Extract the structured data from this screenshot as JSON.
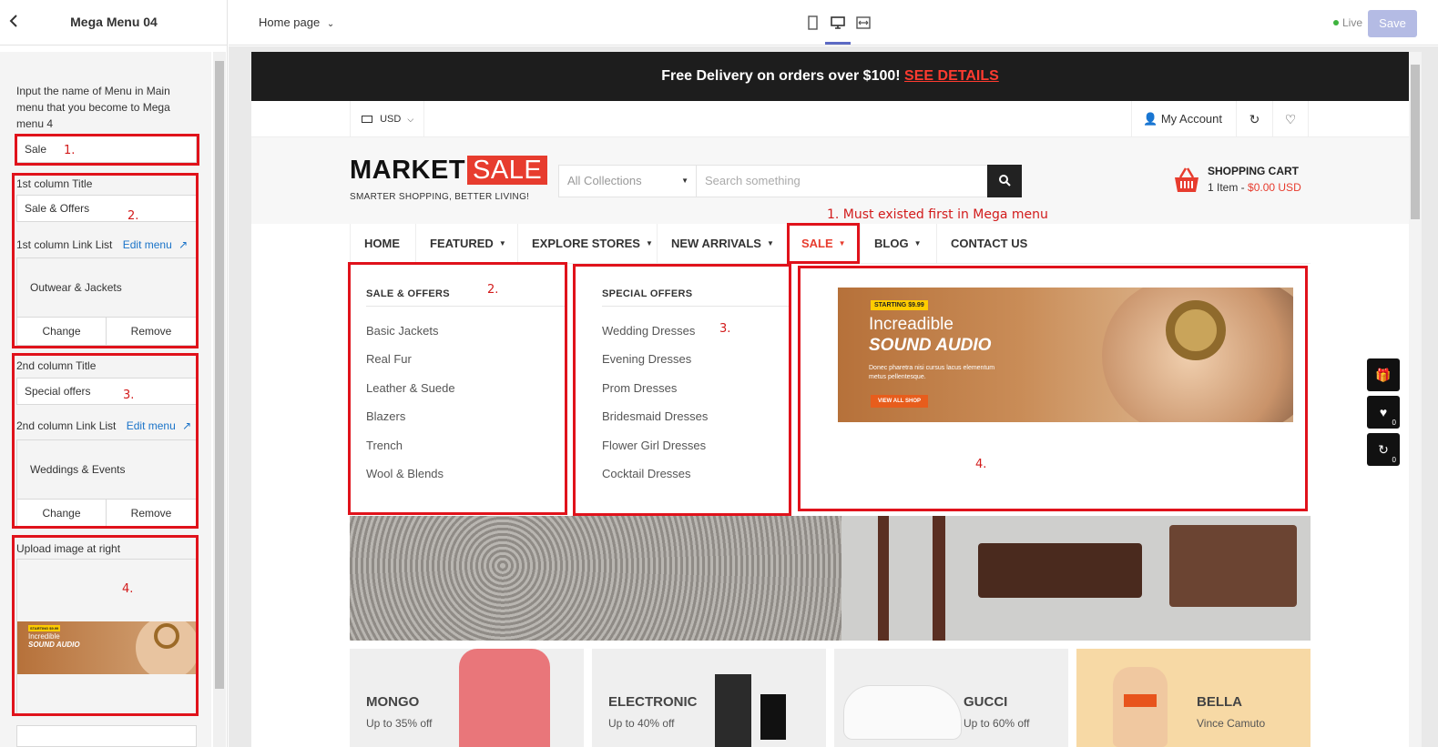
{
  "sidebar": {
    "back_icon": "chevron-left-icon",
    "title": "Mega Menu 04",
    "instruction": "Input the name of Menu in Main menu that you become to Mega menu 4",
    "menu_name_value": "Sale",
    "col1": {
      "title_label": "1st column Title",
      "title_value": "Sale & Offers",
      "link_label": "1st column Link List",
      "edit_link": "Edit menu",
      "linked_menu": "Outwear & Jackets",
      "change": "Change",
      "remove": "Remove"
    },
    "col2": {
      "title_label": "2nd column Title",
      "title_value": "Special offers",
      "link_label": "2nd column Link List",
      "edit_link": "Edit menu",
      "linked_menu": "Weddings & Events",
      "change": "Change",
      "remove": "Remove"
    },
    "upload_label": "Upload image at right",
    "thumb": {
      "badge": "STARTING $9.99",
      "line1": "Incredible",
      "line2": "SOUND AUDIO"
    }
  },
  "topbar": {
    "page_select": "Home page",
    "live": "Live",
    "save": "Save"
  },
  "annotations": {
    "n1": "1.",
    "n2": "2.",
    "n3": "3.",
    "n4": "4.",
    "note": "1. Must existed first in Mega menu"
  },
  "store": {
    "announcement": "Free Delivery on orders over $100!",
    "announcement_link": "SEE DETAILS",
    "currency": "USD",
    "my_account": "My Account",
    "logo_main": "MARKET",
    "logo_sale": "SALE",
    "tagline": "SMARTER SHOPPING, BETTER LIVING!",
    "collections": "All Collections",
    "search_placeholder": "Search something",
    "cart_title": "SHOPPING CART",
    "cart_items": "1 Item -",
    "cart_price": "$0.00 USD",
    "nav": [
      "HOME",
      "FEATURED",
      "EXPLORE STORES",
      "NEW ARRIVALS",
      "SALE",
      "BLOG",
      "CONTACT US"
    ],
    "col1_title": "SALE & OFFERS",
    "col1_links": [
      "Basic Jackets",
      "Real Fur",
      "Leather & Suede",
      "Blazers",
      "Trench",
      "Wool & Blends"
    ],
    "col2_title": "SPECIAL OFFERS",
    "col2_links": [
      "Wedding Dresses",
      "Evening Dresses",
      "Prom Dresses",
      "Bridesmaid Dresses",
      "Flower Girl Dresses",
      "Cocktail Dresses"
    ],
    "banner": {
      "badge": "STARTING $9.99",
      "line1": "Increadible",
      "line2": "SOUND AUDIO",
      "desc": "Donec pharetra nisi cursus lacus elementum metus pellentesque.",
      "button": "VIEW ALL SHOP"
    },
    "categories": [
      {
        "name": "MONGO",
        "sub": "Up to 35% off"
      },
      {
        "name": "ELECTRONIC",
        "sub": "Up to 40% off"
      },
      {
        "name": "GUCCI",
        "sub": "Up to 60% off"
      },
      {
        "name": "BELLA",
        "sub": "Vince Camuto"
      }
    ],
    "floating": {
      "wishlist_count": "0",
      "compare_count": "0"
    }
  },
  "colors": {
    "accent_red": "#e73c2e",
    "annotation_red": "#e0121b",
    "save_button": "#b4bbe4",
    "announcement_bg": "#1d1d1d"
  }
}
